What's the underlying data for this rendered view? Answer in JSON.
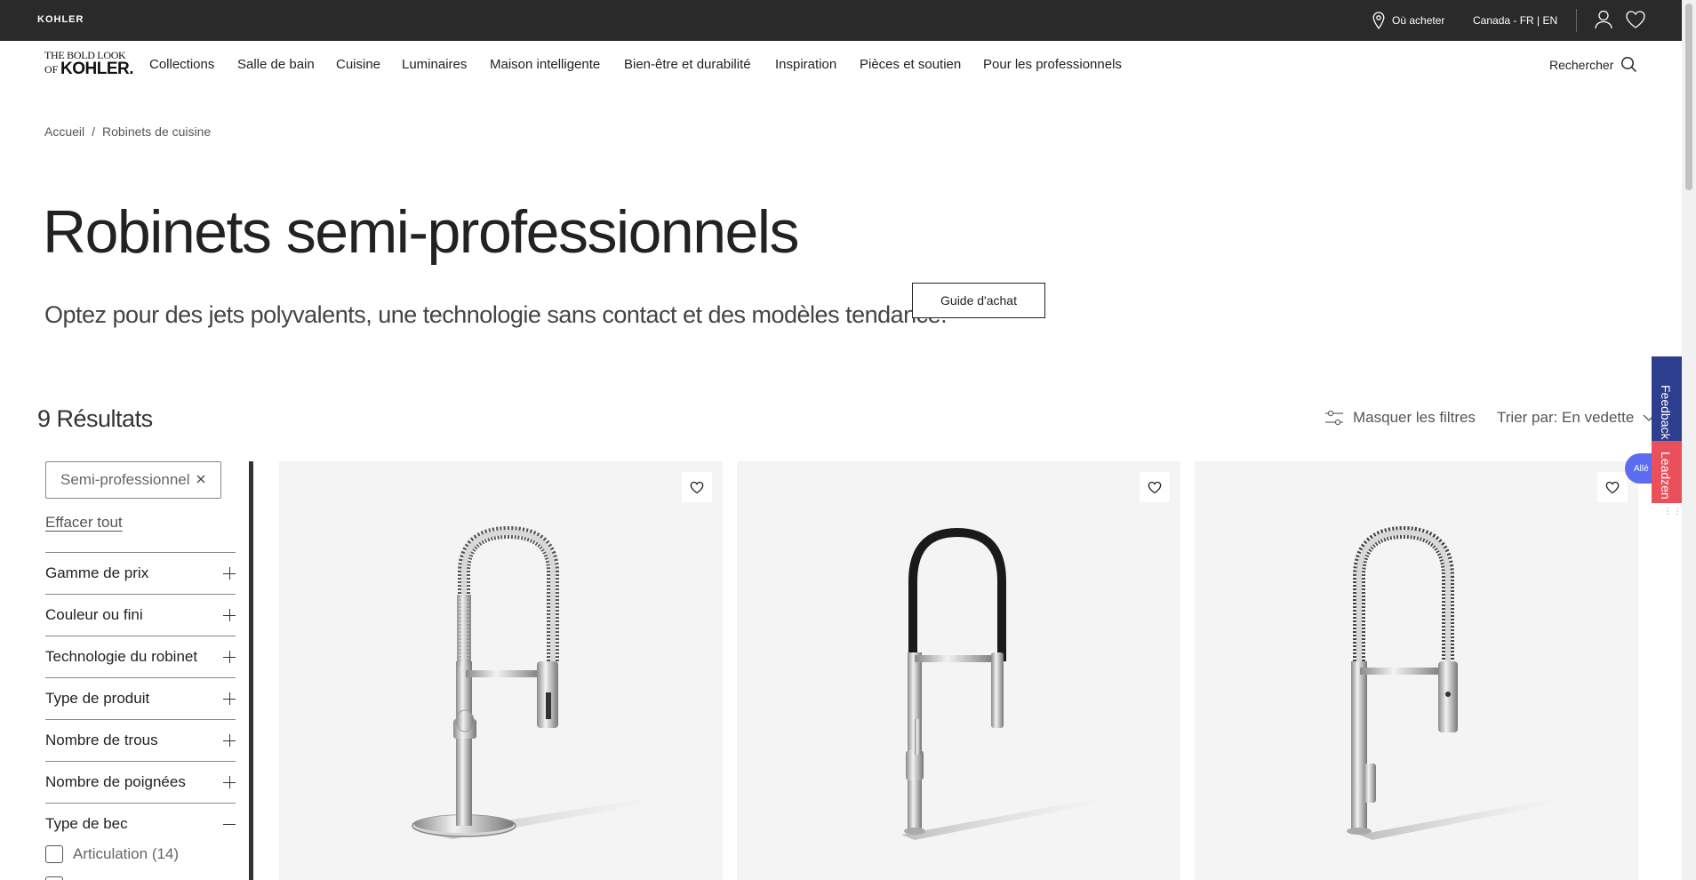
{
  "utility_bar": {
    "brand": "KOHLER",
    "where_to_buy": "Où acheter",
    "locale": "Canada - FR | EN",
    "icons": [
      "location-pin-icon",
      "user-icon",
      "heart-icon"
    ]
  },
  "logo": {
    "line1": "THE BOLD LOOK",
    "line2": "OF",
    "line3": "KOHLER."
  },
  "nav": {
    "items": [
      "Collections",
      "Salle de bain",
      "Cuisine",
      "Luminaires",
      "Maison intelligente",
      "Bien-être et durabilité",
      "Inspiration",
      "Pièces et soutien",
      "Pour les professionnels"
    ],
    "search_label": "Rechercher"
  },
  "breadcrumb": {
    "home": "Accueil",
    "separator": "/",
    "current": "Robinets de cuisine"
  },
  "hero": {
    "title": "Robinets semi-professionnels",
    "subtitle": "Optez pour des jets polyvalents, une technologie sans contact et des modèles tendance.",
    "guide_button": "Guide d'achat"
  },
  "results": {
    "count_label": "9 Résultats",
    "hide_filters": "Masquer les filtres",
    "sort_label": "Trier par: En vedette"
  },
  "filters": {
    "active_chip": "Semi-professionnel",
    "clear_all": "Effacer tout",
    "facets": [
      {
        "label": "Gamme de prix",
        "expanded": false
      },
      {
        "label": "Couleur ou fini",
        "expanded": false
      },
      {
        "label": "Technologie du robinet",
        "expanded": false
      },
      {
        "label": "Type de produit",
        "expanded": false
      },
      {
        "label": "Nombre de trous",
        "expanded": false
      },
      {
        "label": "Nombre de poignées",
        "expanded": false
      },
      {
        "label": "Type de bec",
        "expanded": true
      }
    ],
    "spout_options": [
      {
        "label": "Articulation (14)",
        "checked": false
      }
    ]
  },
  "products": [
    {
      "style": "coil-spring-with-deckplate"
    },
    {
      "style": "black-hose-arch"
    },
    {
      "style": "coil-spring-tall-body"
    }
  ],
  "side_tabs": {
    "feedback": "Feedback",
    "leadzen": "Leadzen",
    "assist": "Allé"
  },
  "colors": {
    "utility_bar_bg": "#2a2a2a",
    "card_bg": "#f4f4f4",
    "feedback_tab": "#2d3e8f",
    "leadzen_tab": "#e8505b",
    "assist_pill": "#5b6cf0"
  }
}
